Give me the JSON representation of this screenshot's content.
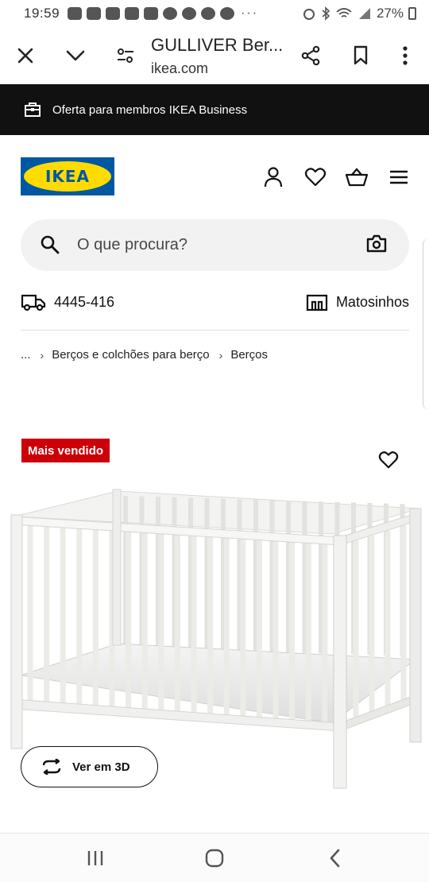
{
  "status_bar": {
    "time": "19:59",
    "battery": "27%",
    "overflow": "···"
  },
  "browser": {
    "page_title": "GULLIVER Ber...",
    "url": "ikea.com"
  },
  "banner": {
    "text": "Oferta para membros IKEA Business"
  },
  "header": {
    "logo_text": "IKEA",
    "brand_blue": "#0058a3",
    "brand_yellow": "#ffdb00"
  },
  "search": {
    "placeholder": "O que procura?"
  },
  "delivery": {
    "postal_code": "4445-416",
    "store": "Matosinhos"
  },
  "breadcrumb": {
    "ellipsis": "...",
    "items": [
      "Berços e colchões para berço",
      "Berços"
    ]
  },
  "product": {
    "badge": "Mais vendido",
    "badge_color": "#cc0008",
    "view_3d_label": "Ver em 3D"
  },
  "icons": {
    "close": "close-icon",
    "chevron": "chevron-down-icon",
    "site_settings": "tune-icon",
    "share": "share-icon",
    "bookmark": "bookmark-icon",
    "menu": "more-vertical-icon",
    "business": "briefcase-icon",
    "account": "user-icon",
    "wishlist": "heart-icon",
    "cart": "basket-icon",
    "hamburger": "hamburger-menu-icon",
    "search": "search-icon",
    "camera": "camera-icon",
    "delivery": "truck-icon",
    "store": "store-icon"
  }
}
